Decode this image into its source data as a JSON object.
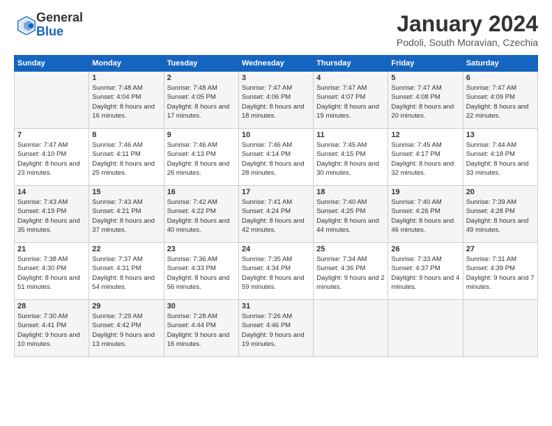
{
  "logo": {
    "general": "General",
    "blue": "Blue"
  },
  "header": {
    "title": "January 2024",
    "location": "Podoli, South Moravian, Czechia"
  },
  "days": [
    "Sunday",
    "Monday",
    "Tuesday",
    "Wednesday",
    "Thursday",
    "Friday",
    "Saturday"
  ],
  "weeks": [
    [
      {
        "day": "",
        "sunrise": "",
        "sunset": "",
        "daylight": ""
      },
      {
        "day": "1",
        "sunrise": "Sunrise: 7:48 AM",
        "sunset": "Sunset: 4:04 PM",
        "daylight": "Daylight: 8 hours and 16 minutes."
      },
      {
        "day": "2",
        "sunrise": "Sunrise: 7:48 AM",
        "sunset": "Sunset: 4:05 PM",
        "daylight": "Daylight: 8 hours and 17 minutes."
      },
      {
        "day": "3",
        "sunrise": "Sunrise: 7:47 AM",
        "sunset": "Sunset: 4:06 PM",
        "daylight": "Daylight: 8 hours and 18 minutes."
      },
      {
        "day": "4",
        "sunrise": "Sunrise: 7:47 AM",
        "sunset": "Sunset: 4:07 PM",
        "daylight": "Daylight: 8 hours and 19 minutes."
      },
      {
        "day": "5",
        "sunrise": "Sunrise: 7:47 AM",
        "sunset": "Sunset: 4:08 PM",
        "daylight": "Daylight: 8 hours and 20 minutes."
      },
      {
        "day": "6",
        "sunrise": "Sunrise: 7:47 AM",
        "sunset": "Sunset: 4:09 PM",
        "daylight": "Daylight: 8 hours and 22 minutes."
      }
    ],
    [
      {
        "day": "7",
        "sunrise": "Sunrise: 7:47 AM",
        "sunset": "Sunset: 4:10 PM",
        "daylight": "Daylight: 8 hours and 23 minutes."
      },
      {
        "day": "8",
        "sunrise": "Sunrise: 7:46 AM",
        "sunset": "Sunset: 4:11 PM",
        "daylight": "Daylight: 8 hours and 25 minutes."
      },
      {
        "day": "9",
        "sunrise": "Sunrise: 7:46 AM",
        "sunset": "Sunset: 4:13 PM",
        "daylight": "Daylight: 8 hours and 26 minutes."
      },
      {
        "day": "10",
        "sunrise": "Sunrise: 7:46 AM",
        "sunset": "Sunset: 4:14 PM",
        "daylight": "Daylight: 8 hours and 28 minutes."
      },
      {
        "day": "11",
        "sunrise": "Sunrise: 7:45 AM",
        "sunset": "Sunset: 4:15 PM",
        "daylight": "Daylight: 8 hours and 30 minutes."
      },
      {
        "day": "12",
        "sunrise": "Sunrise: 7:45 AM",
        "sunset": "Sunset: 4:17 PM",
        "daylight": "Daylight: 8 hours and 32 minutes."
      },
      {
        "day": "13",
        "sunrise": "Sunrise: 7:44 AM",
        "sunset": "Sunset: 4:18 PM",
        "daylight": "Daylight: 8 hours and 33 minutes."
      }
    ],
    [
      {
        "day": "14",
        "sunrise": "Sunrise: 7:43 AM",
        "sunset": "Sunset: 4:19 PM",
        "daylight": "Daylight: 8 hours and 35 minutes."
      },
      {
        "day": "15",
        "sunrise": "Sunrise: 7:43 AM",
        "sunset": "Sunset: 4:21 PM",
        "daylight": "Daylight: 8 hours and 37 minutes."
      },
      {
        "day": "16",
        "sunrise": "Sunrise: 7:42 AM",
        "sunset": "Sunset: 4:22 PM",
        "daylight": "Daylight: 8 hours and 40 minutes."
      },
      {
        "day": "17",
        "sunrise": "Sunrise: 7:41 AM",
        "sunset": "Sunset: 4:24 PM",
        "daylight": "Daylight: 8 hours and 42 minutes."
      },
      {
        "day": "18",
        "sunrise": "Sunrise: 7:40 AM",
        "sunset": "Sunset: 4:25 PM",
        "daylight": "Daylight: 8 hours and 44 minutes."
      },
      {
        "day": "19",
        "sunrise": "Sunrise: 7:40 AM",
        "sunset": "Sunset: 4:26 PM",
        "daylight": "Daylight: 8 hours and 46 minutes."
      },
      {
        "day": "20",
        "sunrise": "Sunrise: 7:39 AM",
        "sunset": "Sunset: 4:28 PM",
        "daylight": "Daylight: 8 hours and 49 minutes."
      }
    ],
    [
      {
        "day": "21",
        "sunrise": "Sunrise: 7:38 AM",
        "sunset": "Sunset: 4:30 PM",
        "daylight": "Daylight: 8 hours and 51 minutes."
      },
      {
        "day": "22",
        "sunrise": "Sunrise: 7:37 AM",
        "sunset": "Sunset: 4:31 PM",
        "daylight": "Daylight: 8 hours and 54 minutes."
      },
      {
        "day": "23",
        "sunrise": "Sunrise: 7:36 AM",
        "sunset": "Sunset: 4:33 PM",
        "daylight": "Daylight: 8 hours and 56 minutes."
      },
      {
        "day": "24",
        "sunrise": "Sunrise: 7:35 AM",
        "sunset": "Sunset: 4:34 PM",
        "daylight": "Daylight: 8 hours and 59 minutes."
      },
      {
        "day": "25",
        "sunrise": "Sunrise: 7:34 AM",
        "sunset": "Sunset: 4:36 PM",
        "daylight": "Daylight: 9 hours and 2 minutes."
      },
      {
        "day": "26",
        "sunrise": "Sunrise: 7:33 AM",
        "sunset": "Sunset: 4:37 PM",
        "daylight": "Daylight: 9 hours and 4 minutes."
      },
      {
        "day": "27",
        "sunrise": "Sunrise: 7:31 AM",
        "sunset": "Sunset: 4:39 PM",
        "daylight": "Daylight: 9 hours and 7 minutes."
      }
    ],
    [
      {
        "day": "28",
        "sunrise": "Sunrise: 7:30 AM",
        "sunset": "Sunset: 4:41 PM",
        "daylight": "Daylight: 9 hours and 10 minutes."
      },
      {
        "day": "29",
        "sunrise": "Sunrise: 7:29 AM",
        "sunset": "Sunset: 4:42 PM",
        "daylight": "Daylight: 9 hours and 13 minutes."
      },
      {
        "day": "30",
        "sunrise": "Sunrise: 7:28 AM",
        "sunset": "Sunset: 4:44 PM",
        "daylight": "Daylight: 9 hours and 16 minutes."
      },
      {
        "day": "31",
        "sunrise": "Sunrise: 7:26 AM",
        "sunset": "Sunset: 4:46 PM",
        "daylight": "Daylight: 9 hours and 19 minutes."
      },
      {
        "day": "",
        "sunrise": "",
        "sunset": "",
        "daylight": ""
      },
      {
        "day": "",
        "sunrise": "",
        "sunset": "",
        "daylight": ""
      },
      {
        "day": "",
        "sunrise": "",
        "sunset": "",
        "daylight": ""
      }
    ]
  ]
}
